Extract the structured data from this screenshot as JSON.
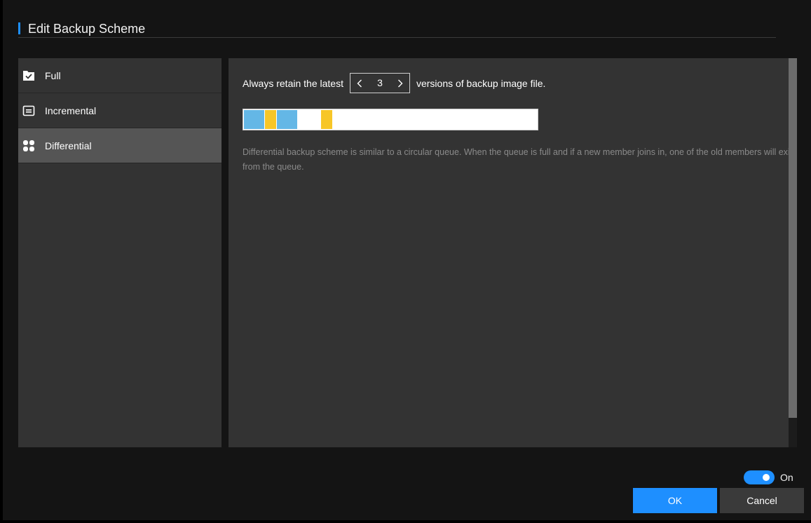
{
  "dialog": {
    "title": "Edit Backup Scheme"
  },
  "sidebar": {
    "items": [
      {
        "label": "Full",
        "icon": "calendar-check-icon",
        "active": false
      },
      {
        "label": "Incremental",
        "icon": "list-box-icon",
        "active": false
      },
      {
        "label": "Differential",
        "icon": "four-dots-icon",
        "active": true
      }
    ]
  },
  "content": {
    "retain_prefix": "Always retain the latest",
    "retain_count": "3",
    "retain_suffix": "versions of backup image file.",
    "description": "Differential backup scheme is similar to a circular queue. When the queue is full and if a new member joins in, one of the old members will exit from the queue.",
    "queue_colors": {
      "full": "#64b7e6",
      "differential": "#f7c628"
    }
  },
  "footer": {
    "toggle_label": "On",
    "toggle_on": true,
    "ok_label": "OK",
    "cancel_label": "Cancel"
  },
  "colors": {
    "accent": "#1e8fff",
    "panel": "#333333",
    "background": "#141414"
  }
}
